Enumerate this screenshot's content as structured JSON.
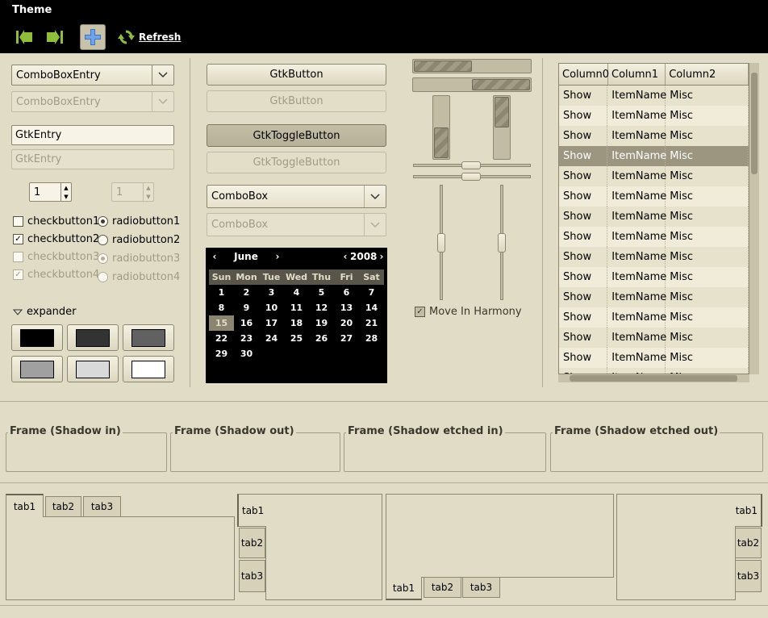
{
  "window": {
    "title": "Theme"
  },
  "toolbar": {
    "refresh_label": "Refresh"
  },
  "col1": {
    "combo_entry": "ComboBoxEntry",
    "combo_entry_disabled": "ComboBoxEntry",
    "entry": "GtkEntry",
    "entry_disabled": "GtkEntry",
    "spin": "1",
    "spin_disabled": "1",
    "checks": [
      "checkbutton1",
      "checkbutton2",
      "checkbutton3",
      "checkbutton4"
    ],
    "radios": [
      "radiobutton1",
      "radiobutton2",
      "radiobutton3",
      "radiobutton4"
    ],
    "expander": "expander",
    "swatch_colors": [
      "#000000",
      "#333333",
      "#616161",
      "#a0a0a0",
      "#d9d9d9",
      "#ffffff"
    ]
  },
  "col2": {
    "button": "GtkButton",
    "button_disabled": "GtkButton",
    "toggle": "GtkToggleButton",
    "toggle_disabled": "GtkToggleButton",
    "combo": "ComboBox",
    "combo_disabled": "ComboBox"
  },
  "calendar": {
    "month": "June",
    "year": "2008",
    "days": [
      "Sun",
      "Mon",
      "Tue",
      "Wed",
      "Thu",
      "Fri",
      "Sat"
    ],
    "weeks": [
      [
        "1",
        "2",
        "3",
        "4",
        "5",
        "6",
        "7"
      ],
      [
        "8",
        "9",
        "10",
        "11",
        "12",
        "13",
        "14"
      ],
      [
        "15",
        "16",
        "17",
        "18",
        "19",
        "20",
        "21"
      ],
      [
        "22",
        "23",
        "24",
        "25",
        "26",
        "27",
        "28"
      ],
      [
        "29",
        "30",
        "",
        "",
        "",
        "",
        ""
      ]
    ],
    "selected": "15"
  },
  "col3": {
    "harmony": "Move In Harmony"
  },
  "tree": {
    "columns": [
      "Column0",
      "Column1",
      "Column2"
    ],
    "rows": [
      [
        "Show",
        "ItemName",
        "Misc"
      ],
      [
        "Show",
        "ItemName",
        "Misc"
      ],
      [
        "Show",
        "ItemName",
        "Misc"
      ],
      [
        "Show",
        "ItemName",
        "Misc"
      ],
      [
        "Show",
        "ItemName",
        "Misc"
      ],
      [
        "Show",
        "ItemName",
        "Misc"
      ],
      [
        "Show",
        "ItemName",
        "Misc"
      ],
      [
        "Show",
        "ItemName",
        "Misc"
      ],
      [
        "Show",
        "ItemName",
        "Misc"
      ],
      [
        "Show",
        "ItemName",
        "Misc"
      ],
      [
        "Show",
        "ItemName",
        "Misc"
      ],
      [
        "Show",
        "ItemName",
        "Misc"
      ],
      [
        "Show",
        "ItemName",
        "Misc"
      ],
      [
        "Show",
        "ItemName",
        "Misc"
      ],
      [
        "Show",
        "ItemName",
        "Misc"
      ]
    ],
    "selected_row": 3
  },
  "frames": [
    "Frame (Shadow in)",
    "Frame (Shadow out)",
    "Frame (Shadow etched in)",
    "Frame (Shadow etched out)"
  ],
  "tabs": [
    "tab1",
    "tab2",
    "tab3"
  ]
}
